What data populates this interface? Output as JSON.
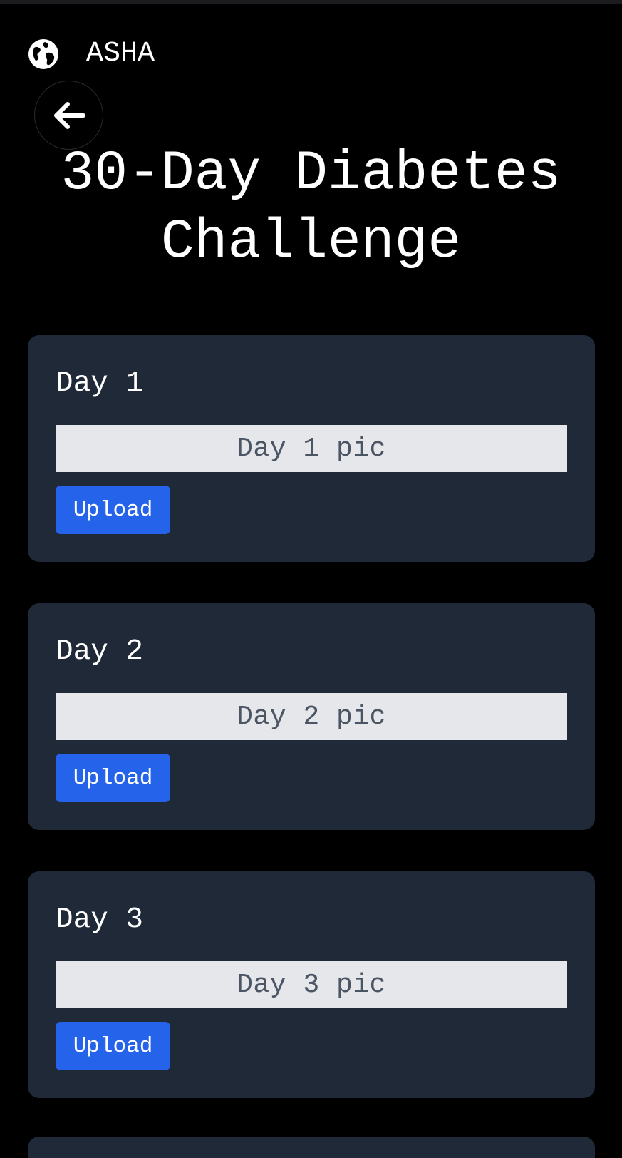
{
  "app": {
    "name": "ASHA",
    "icon": "globe-icon"
  },
  "navigation": {
    "back_icon": "arrow-left-icon"
  },
  "page": {
    "title": "30-Day Diabetes Challenge"
  },
  "days": [
    {
      "title": "Day 1",
      "pic_label": "Day 1 pic",
      "upload_label": "Upload"
    },
    {
      "title": "Day 2",
      "pic_label": "Day 2 pic",
      "upload_label": "Upload"
    },
    {
      "title": "Day 3",
      "pic_label": "Day 3 pic",
      "upload_label": "Upload"
    }
  ],
  "colors": {
    "background": "#000000",
    "card": "#1f2937",
    "pic_box": "#e5e7eb",
    "pic_text": "#4b5563",
    "button": "#2563eb",
    "text": "#ffffff"
  }
}
